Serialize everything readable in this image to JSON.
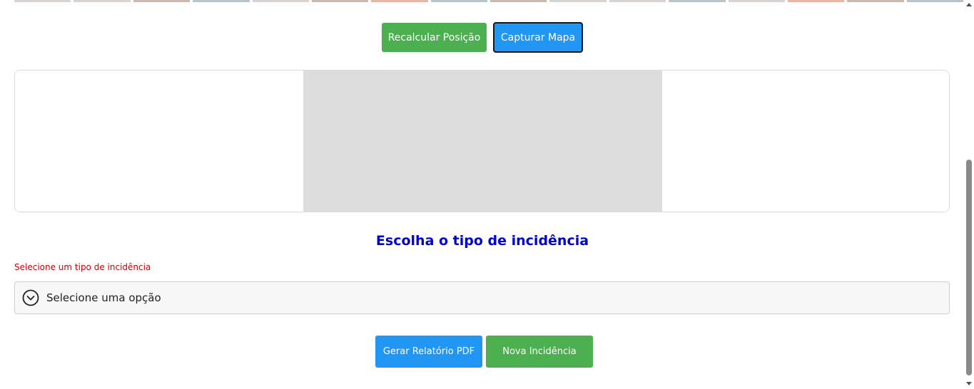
{
  "toolbar": {
    "recalculate_label": "Recalcular Posição",
    "capture_label": "Capturar Mapa"
  },
  "incidence": {
    "title": "Escolha o tipo de incidência",
    "error": "Selecione um tipo de incidência",
    "select_placeholder": "Selecione uma opção"
  },
  "actions": {
    "pdf_label": "Gerar Relatório PDF",
    "new_label": "Nova Incidência"
  },
  "colors": {
    "green": "#4caf50",
    "blue": "#2196f3",
    "title_blue": "#0000cc",
    "error_red": "#cc0000"
  },
  "icons": {
    "select": "chevron-down-circle-icon"
  }
}
